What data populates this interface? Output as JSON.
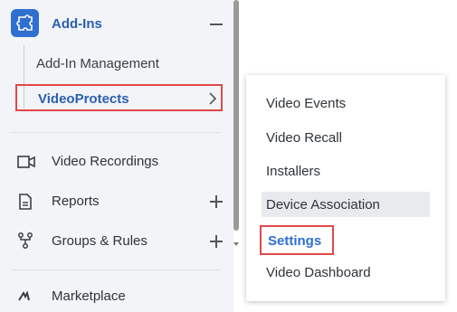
{
  "sidebar": {
    "addins": {
      "label": "Add-Ins",
      "icon": "puzzle-icon",
      "toggle_icon": "minus-icon"
    },
    "addin_management": {
      "label": "Add-In Management"
    },
    "videoprotects": {
      "label": "VideoProtects",
      "icon": "chevron-right-icon"
    },
    "items": [
      {
        "label": "Video Recordings",
        "icon": "video-camera-icon"
      },
      {
        "label": "Reports",
        "icon": "document-icon",
        "expand_icon": "plus-icon"
      },
      {
        "label": "Groups & Rules",
        "icon": "hierarchy-icon",
        "expand_icon": "plus-icon"
      },
      {
        "label": "Marketplace",
        "icon": "marketplace-icon"
      }
    ]
  },
  "submenu": {
    "items": [
      {
        "label": "Video Events"
      },
      {
        "label": "Video Recall"
      },
      {
        "label": "Installers"
      },
      {
        "label": "Device Association"
      },
      {
        "label": "Settings"
      },
      {
        "label": "Video Dashboard"
      }
    ]
  },
  "colors": {
    "accent": "#2f6fd0",
    "highlight_border": "#e04848",
    "sidebar_bg": "#f2f4f7"
  }
}
